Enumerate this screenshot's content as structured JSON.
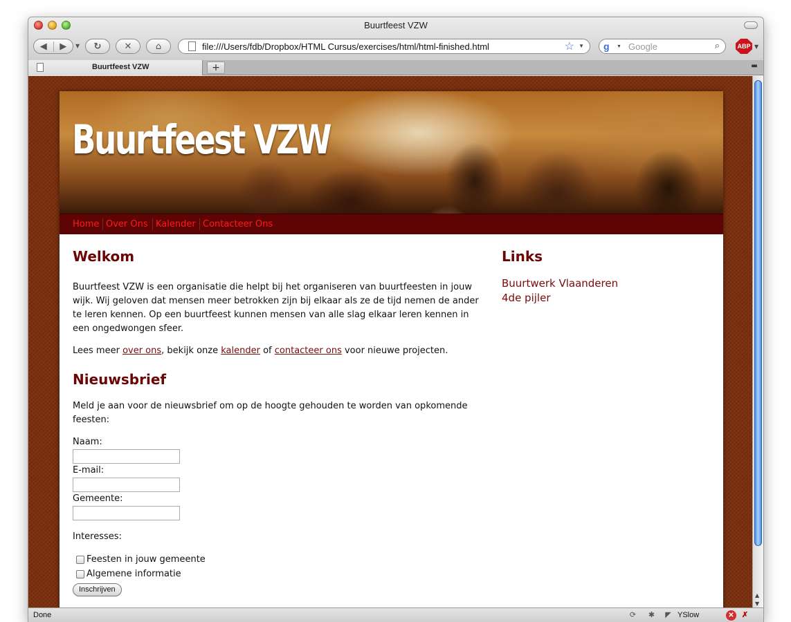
{
  "window": {
    "title": "Buurtfeest VZW"
  },
  "toolbar": {
    "back_icon": "back-arrow-icon",
    "forward_icon": "forward-arrow-icon",
    "url": "file:///Users/fdb/Dropbox/HTML Cursus/exercises/html/html-finished.html",
    "search_placeholder": "Google",
    "abp_label": "ABP"
  },
  "tabs": [
    {
      "label": "Buurtfeest VZW"
    }
  ],
  "site": {
    "banner_title": "Buurtfeest VZW",
    "nav": [
      "Home",
      "Over Ons",
      "Kalender",
      "Contacteer Ons"
    ],
    "nav_color": "#ff1a1a",
    "navbar_bg": "#5e0404",
    "heading_color": "#6b0505"
  },
  "main": {
    "welcome_heading": "Welkom",
    "intro": "Buurtfeest VZW is een organisatie die helpt bij het organiseren van buurtfeesten in jouw wijk. Wij geloven dat mensen meer betrokken zijn bij elkaar als ze de tijd nemen de ander te leren kennen. Op een buurtfeest kunnen mensen van alle slag elkaar leren kennen in een ongedwongen sfeer.",
    "more": {
      "t1": "Lees meer ",
      "link1": "over ons",
      "t2": ", bekijk onze ",
      "link2": "kalender",
      "t3": " of ",
      "link3": "contacteer ons",
      "t4": " voor nieuwe projecten."
    },
    "newsletter_heading": "Nieuwsbrief",
    "newsletter_intro": "Meld je aan voor de nieuwsbrief om op de hoogte gehouden te worden van opkomende feesten:",
    "form": {
      "name_label": "Naam:",
      "email_label": "E-mail:",
      "city_label": "Gemeente:",
      "interests_label": "Interesses:",
      "interest_1": "Feesten in jouw gemeente",
      "interest_2": "Algemene informatie",
      "submit": "Inschrijven"
    }
  },
  "sidebar": {
    "heading": "Links",
    "links": [
      "Buurtwerk Vlaanderen",
      "4de pijler"
    ]
  },
  "statusbar": {
    "text": "Done",
    "yslow": "YSlow"
  }
}
